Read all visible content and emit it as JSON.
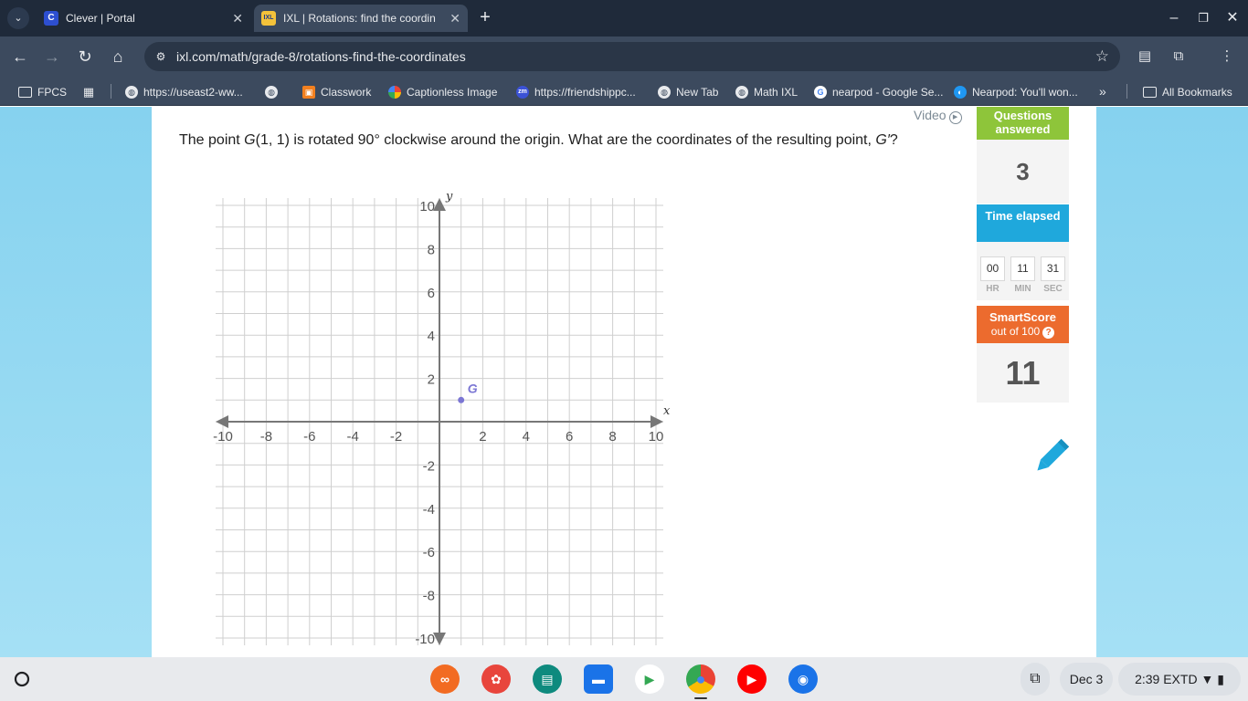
{
  "browser": {
    "tabs": [
      {
        "title": "Clever | Portal",
        "favicon": "C",
        "favicon_color": "#2d4fd0",
        "active": false
      },
      {
        "title": "IXL | Rotations: find the coordin",
        "favicon": "IXL",
        "favicon_color": "#f4c23a",
        "active": true
      }
    ],
    "url": "ixl.com/math/grade-8/rotations-find-the-coordinates",
    "bookmarks": [
      {
        "label": "FPCS",
        "icon": "folder-icon"
      },
      {
        "label": "",
        "icon": "apps-grid-icon"
      },
      {
        "label": "https://useast2-ww...",
        "icon": "globe-icon"
      },
      {
        "label": "",
        "icon": "globe-icon"
      },
      {
        "label": "Classwork",
        "icon": "classwork-icon"
      },
      {
        "label": "Captionless Image",
        "icon": "pinwheel-icon"
      },
      {
        "label": "https://friendshippc...",
        "icon": "zoom-icon",
        "badge": "zm"
      },
      {
        "label": "New Tab",
        "icon": "globe-icon"
      },
      {
        "label": "Math IXL",
        "icon": "globe-icon"
      },
      {
        "label": "nearpod - Google Se...",
        "icon": "google-icon"
      },
      {
        "label": "Nearpod: You'll won...",
        "icon": "nearpod-icon"
      }
    ],
    "more_bookmarks": "»",
    "all_bookmarks": "All Bookmarks"
  },
  "question": {
    "parts": [
      "The point ",
      "G",
      "(1, 1) is rotated 90° clockwise around the origin. What are the coordinates of the resulting point, ",
      "G′",
      "?"
    ],
    "video_label": "Video"
  },
  "graph": {
    "x_label": "x",
    "y_label": "y",
    "range": [
      -10,
      10
    ],
    "tick_step": 2,
    "grid_step": 1,
    "point": {
      "label": "G",
      "x": 1,
      "y": 1,
      "color": "#7b76d4"
    }
  },
  "stats": {
    "questions_answered_label": "Questions answered",
    "questions_answered": "3",
    "time_elapsed_label": "Time elapsed",
    "time": {
      "hr": "00",
      "min": "11",
      "sec": "31"
    },
    "time_units": {
      "hr": "HR",
      "min": "MIN",
      "sec": "SEC"
    },
    "smartscore_label": "SmartScore",
    "smartscore_sub": "out of 100",
    "smartscore_help": "?",
    "smartscore": "11"
  },
  "shelf": {
    "apps": [
      {
        "name": "app-orange-icon",
        "color": "#f26b22",
        "glyph": "∞"
      },
      {
        "name": "canvas-icon",
        "color": "#e8453c",
        "glyph": "✿"
      },
      {
        "name": "classroom-icon",
        "color": "#0e8a7e",
        "glyph": "▤"
      },
      {
        "name": "files-icon",
        "color": "#1a73e8",
        "glyph": "▬"
      },
      {
        "name": "play-store-icon",
        "color": "#ffffff",
        "glyph": "▶"
      },
      {
        "name": "chrome-icon",
        "color": "#4285f4",
        "glyph": "●"
      },
      {
        "name": "youtube-icon",
        "color": "#ff0000",
        "glyph": "▶"
      },
      {
        "name": "camera-icon",
        "color": "#1a73e8",
        "glyph": "◉"
      }
    ],
    "date": "Dec 3",
    "time": "2:39",
    "time_suffix": "EXTD"
  }
}
